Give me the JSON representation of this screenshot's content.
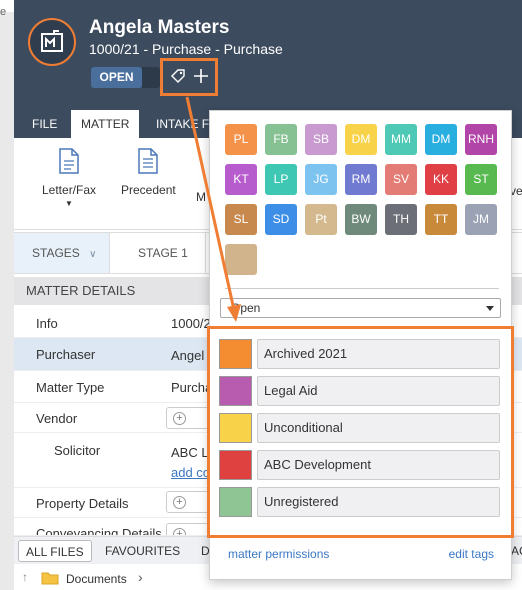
{
  "background": {
    "partial_letter": "e"
  },
  "header": {
    "title": "Angela Masters",
    "subtitle": "1000/21 - Purchase - Purchase",
    "status": "OPEN"
  },
  "tabs": [
    "FILE",
    "MATTER",
    "INTAKE FO"
  ],
  "ribbon": [
    {
      "label": "Letter/Fax",
      "has_dropdown": true
    },
    {
      "label": "Precedent",
      "has_dropdown": false
    },
    {
      "label": "M",
      "has_dropdown": false
    }
  ],
  "ribbon_edge_text": "ve",
  "stages": [
    "STAGES",
    "STAGE 1"
  ],
  "matter_details": {
    "heading": "MATTER DETAILS",
    "rows": [
      {
        "key": "Info",
        "value": "1000/2"
      },
      {
        "key": "Purchaser",
        "value": "Angel"
      },
      {
        "key": "Matter Type",
        "value": "Purcha"
      },
      {
        "key": "Vendor",
        "value": ""
      },
      {
        "key": "Solicitor",
        "value": "ABC L",
        "link": "add co"
      },
      {
        "key": "Property Details",
        "value": ""
      },
      {
        "key": "Conveyancing Details",
        "value": ""
      }
    ]
  },
  "files": {
    "tabs": [
      "ALL FILES",
      "FAVOURITES",
      "D"
    ],
    "edge_text": "AC",
    "breadcrumb": "Documents"
  },
  "popup": {
    "swatches": [
      {
        "label": "PL",
        "color": "#f5924a"
      },
      {
        "label": "FB",
        "color": "#86c193"
      },
      {
        "label": "SB",
        "color": "#c89ad0"
      },
      {
        "label": "DM",
        "color": "#f8d34a"
      },
      {
        "label": "MM",
        "color": "#4ec9b5"
      },
      {
        "label": "DM",
        "color": "#29aee0"
      },
      {
        "label": "RNH",
        "color": "#b245a8"
      },
      {
        "label": "KT",
        "color": "#b75ccc"
      },
      {
        "label": "LP",
        "color": "#3ec7b2"
      },
      {
        "label": "JG",
        "color": "#7cc4ef"
      },
      {
        "label": "RM",
        "color": "#6f7ad0"
      },
      {
        "label": "SV",
        "color": "#e37c74"
      },
      {
        "label": "KK",
        "color": "#df3f45"
      },
      {
        "label": "ST",
        "color": "#58b950"
      },
      {
        "label": "SL",
        "color": "#c8894e"
      },
      {
        "label": "SD",
        "color": "#3d8ee7"
      },
      {
        "label": "Pt",
        "color": "#d4b88e"
      },
      {
        "label": "BW",
        "color": "#6f8a7a"
      },
      {
        "label": "TH",
        "color": "#6c6f78"
      },
      {
        "label": "TT",
        "color": "#c8893b"
      },
      {
        "label": "JM",
        "color": "#9aa2b4"
      },
      {
        "label": "",
        "color": "#d2b48c"
      }
    ],
    "filter_value": "Open",
    "tags": [
      {
        "name": "Archived 2021",
        "color": "#f48c32"
      },
      {
        "name": "Legal Aid",
        "color": "#b85cb0"
      },
      {
        "name": "Unconditional",
        "color": "#f8d34a"
      },
      {
        "name": "ABC Development",
        "color": "#df4141"
      },
      {
        "name": "Unregistered",
        "color": "#8fc494"
      }
    ],
    "footer_left": "matter permissions",
    "footer_right": "edit tags"
  },
  "accent": "#ef7d33"
}
